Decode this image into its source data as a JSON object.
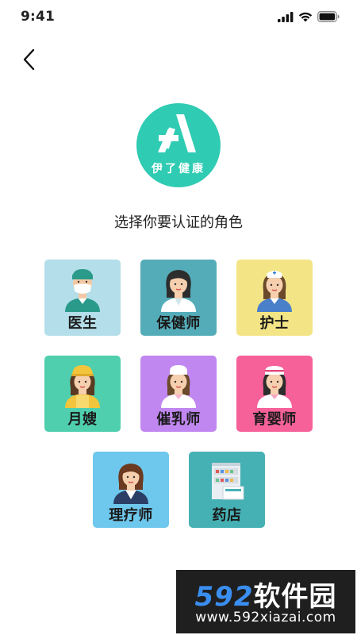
{
  "status_bar": {
    "time": "9:41",
    "icons": [
      "signal-icon",
      "wifi-icon",
      "battery-icon"
    ]
  },
  "header": {
    "back_icon": "chevron-left-icon"
  },
  "logo": {
    "text": "伊了健康",
    "color": "#2fcbb3"
  },
  "subtitle": "选择你要认证的角色",
  "roles": [
    {
      "label": "医生",
      "bg": "#b4dee9",
      "icon": "doctor-avatar-icon"
    },
    {
      "label": "保健师",
      "bg": "#55acb9",
      "icon": "health-care-avatar-icon"
    },
    {
      "label": "护士",
      "bg": "#f3e585",
      "icon": "nurse-avatar-icon"
    },
    {
      "label": "月嫂",
      "bg": "#4fcfae",
      "icon": "maternity-nanny-avatar-icon"
    },
    {
      "label": "催乳师",
      "bg": "#c187f1",
      "icon": "lactation-avatar-icon"
    },
    {
      "label": "育婴师",
      "bg": "#f6619a",
      "icon": "nursery-avatar-icon"
    },
    {
      "label": "理疗师",
      "bg": "#6ec7ec",
      "icon": "therapist-avatar-icon"
    },
    {
      "label": "药店",
      "bg": "#45b1b4",
      "icon": "pharmacy-icon"
    }
  ],
  "watermark": {
    "number": "592",
    "brand": "软件园",
    "url": "www.592xiazai.com"
  }
}
